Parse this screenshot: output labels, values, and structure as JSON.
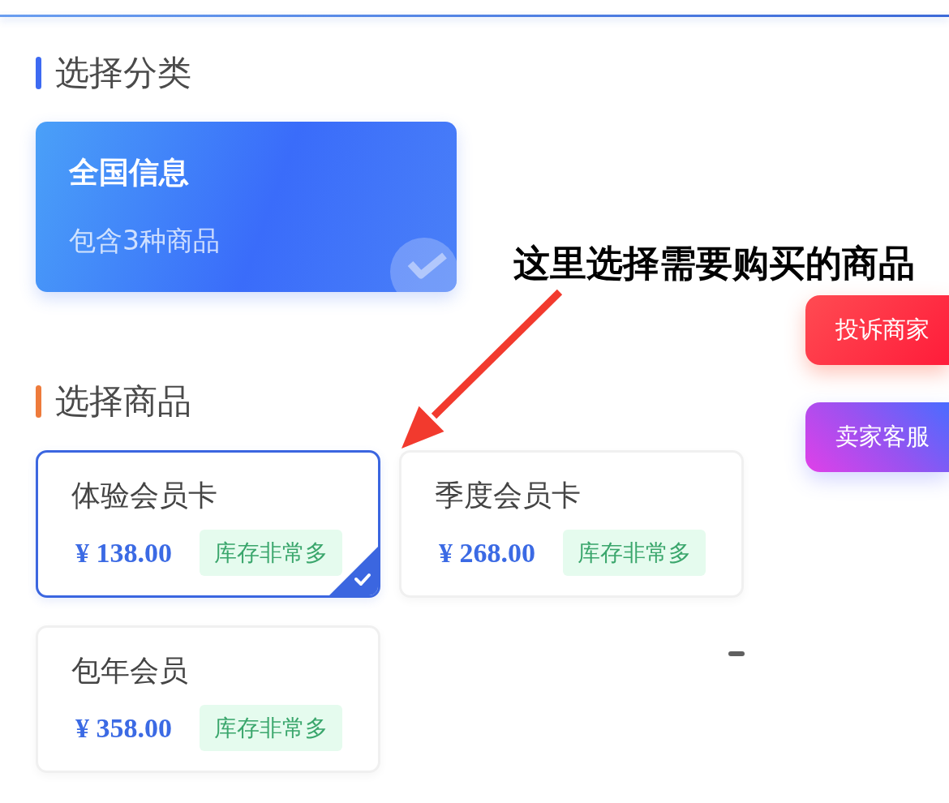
{
  "sections": [
    {
      "kind": "categories",
      "title": "选择分类",
      "color": "#3d6af2",
      "categories": [
        {
          "title": "全国信息",
          "subtitle": "包含3种商品",
          "selected": true
        }
      ]
    },
    {
      "kind": "products",
      "title": "选择商品",
      "color": "#ee7b3b",
      "products": [
        {
          "name": "体验会员卡",
          "price": "¥ 138.00",
          "stock": "库存非常多",
          "selected": true
        },
        {
          "name": "季度会员卡",
          "price": "¥ 268.00",
          "stock": "库存非常多",
          "selected": false
        },
        {
          "name": "包年会员",
          "price": "¥ 358.00",
          "stock": "库存非常多",
          "selected": false
        }
      ]
    }
  ],
  "annotation": {
    "text": "这里选择需要购买的商品"
  },
  "floating_buttons": [
    {
      "label": "投诉商家",
      "kind": "complaint"
    },
    {
      "label": "卖家客服",
      "kind": "service"
    }
  ]
}
